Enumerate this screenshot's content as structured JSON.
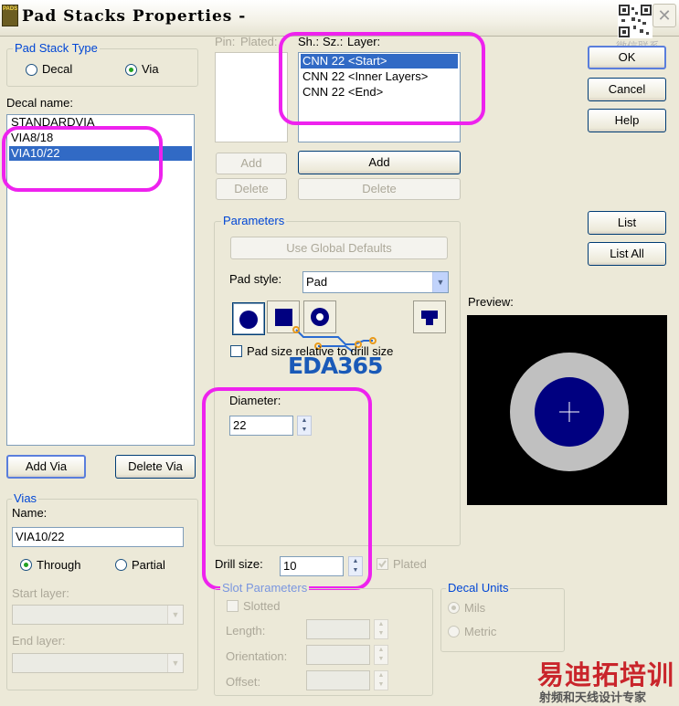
{
  "window": {
    "title": "Pad Stacks Properties -",
    "app_badge": "PADS"
  },
  "pad_stack_type": {
    "legend": "Pad Stack Type",
    "decal": "Decal",
    "via": "Via",
    "selected": "via"
  },
  "decal_name": {
    "label": "Decal name:",
    "items": [
      "STANDARDVIA",
      "VIA8/18",
      "VIA10/22"
    ],
    "selected_index": 2
  },
  "buttons": {
    "add_via": "Add Via",
    "delete_via": "Delete Via",
    "ok": "OK",
    "cancel": "Cancel",
    "help": "Help",
    "list": "List",
    "list_all": "List All"
  },
  "vias": {
    "legend": "Vias",
    "name_label": "Name:",
    "name_value": "VIA10/22",
    "through": "Through",
    "partial": "Partial",
    "selected": "through",
    "start_layer": "Start layer:",
    "end_layer": "End layer:"
  },
  "pin_table": {
    "pin": "Pin:",
    "plated": "Plated:",
    "add": "Add",
    "delete": "Delete"
  },
  "layer_table": {
    "sh": "Sh.:",
    "sz": "Sz.:",
    "layer": "Layer:",
    "items": [
      "CNN 22 <Start>",
      "CNN 22 <Inner Layers>",
      "CNN 22 <End>"
    ],
    "selected_index": 0,
    "add": "Add",
    "delete": "Delete"
  },
  "parameters": {
    "legend": "Parameters",
    "use_global_defaults": "Use Global Defaults",
    "pad_style_label": "Pad style:",
    "pad_style_value": "Pad",
    "pad_size_relative": "Pad size relative to drill size",
    "diameter_label": "Diameter:",
    "diameter_value": "22"
  },
  "drill": {
    "label": "Drill size:",
    "value": "10",
    "plated": "Plated"
  },
  "slot": {
    "legend": "Slot Parameters",
    "slotted": "Slotted",
    "length": "Length:",
    "orientation": "Orientation:",
    "offset": "Offset:"
  },
  "decal_units": {
    "legend": "Decal Units",
    "mils": "Mils",
    "metric": "Metric",
    "selected": "mils"
  },
  "preview": {
    "label": "Preview:"
  },
  "watermarks": {
    "eda": "EDA365",
    "wechat": "微信联系",
    "cn_brand": "易迪拓培训",
    "cn_sub": "射频和天线设计专家"
  },
  "colors": {
    "pad_navy": "#000080",
    "antipad_gray": "#c0c0c0",
    "highlight_magenta": "#ee22ee",
    "selection_blue": "#316ac5",
    "eda_blue": "#1a5ab8",
    "brand_red": "#c9252b"
  }
}
